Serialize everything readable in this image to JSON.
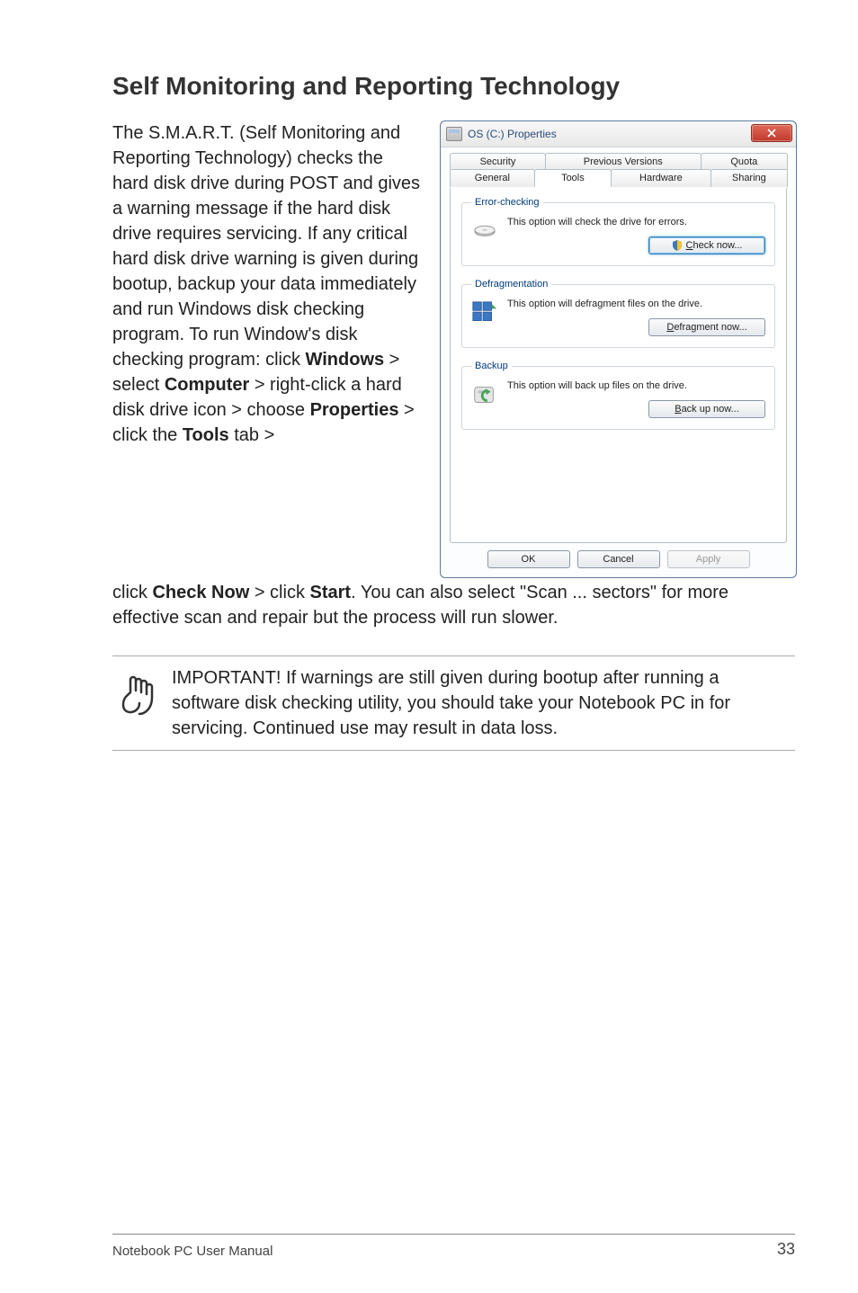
{
  "section_title": "Self Monitoring and Reporting Technology",
  "body_left_html_parts": [
    "The S.M.A.R.T. (Self Monitoring and Reporting Technology) checks the hard disk drive during POST and gives a warning message if the hard disk drive requires servicing. If any critical hard disk drive warning is given during bootup, backup your data immediately and run Windows disk checking program. To run Window's disk checking program: click ",
    "Windows",
    " > select ",
    "Computer",
    " > right-click a hard disk drive icon > choose ",
    "Properties",
    " > click the ",
    "Tools",
    " tab > "
  ],
  "after_parts": [
    "click ",
    "Check Now",
    " > click ",
    "Start",
    ". You can also select \"Scan ... sectors\" for more effective scan and repair but the process will run slower."
  ],
  "note_text": "IMPORTANT! If warnings are still given during bootup after running a software disk checking utility, you should take your Notebook PC in for servicing. Continued use may result in data loss.",
  "dialog": {
    "title": "OS (C:) Properties",
    "tabs_top": [
      "Security",
      "Previous Versions",
      "Quota"
    ],
    "tabs_bottom": [
      "General",
      "Tools",
      "Hardware",
      "Sharing"
    ],
    "active_tab": "Tools",
    "groups": {
      "error": {
        "legend": "Error-checking",
        "desc": "This option will check the drive for errors.",
        "btn_pre": "C",
        "btn_rest": "heck now..."
      },
      "defrag": {
        "legend": "Defragmentation",
        "desc": "This option will defragment files on the drive.",
        "btn_pre": "D",
        "btn_rest": "efragment now..."
      },
      "backup": {
        "legend": "Backup",
        "desc": "This option will back up files on the drive.",
        "btn_pre": "B",
        "btn_rest": "ack up now..."
      }
    },
    "ok": "OK",
    "cancel": "Cancel",
    "apply": "Apply"
  },
  "footer_text": "Notebook PC User Manual",
  "page_number": "33"
}
